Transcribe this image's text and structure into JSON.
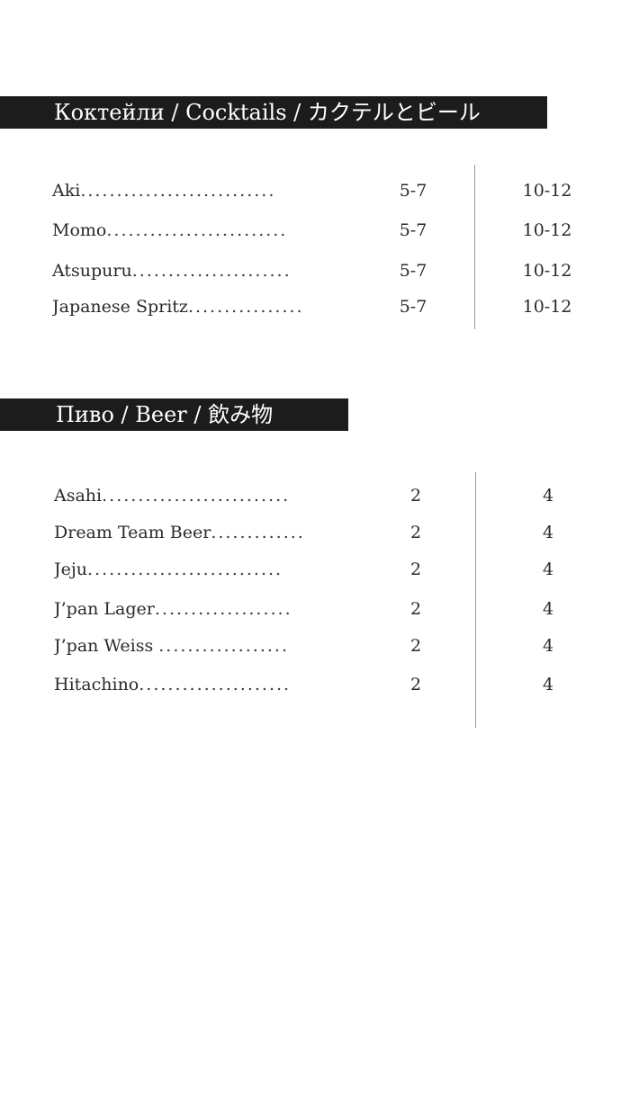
{
  "cocktails": {
    "title": "Коктейли / Cocktails / カクテルとビール",
    "items": [
      {
        "name": "Aki",
        "dots": "...........................",
        "small": "5-7",
        "large": "10-12"
      },
      {
        "name": "Momo",
        "dots": ".........................",
        "small": "5-7",
        "large": "10-12"
      },
      {
        "name": "Atsupuru",
        "dots": "......................",
        "small": "5-7",
        "large": "10-12"
      },
      {
        "name": "Japanese Spritz",
        "dots": "................",
        "small": "5-7",
        "large": "10-12"
      }
    ]
  },
  "beer": {
    "title": "Пиво / Beer / 飲み物",
    "items": [
      {
        "name": "Asahi",
        "dots": "..........................",
        "small": "2",
        "large": "4"
      },
      {
        "name": "Dream Team Beer",
        "dots": ".............",
        "small": "2",
        "large": "4"
      },
      {
        "name": "Jeju",
        "dots": "...........................",
        "small": "2",
        "large": "4"
      },
      {
        "name": "J’pan Lager",
        "dots": "...................",
        "small": "2",
        "large": "4"
      },
      {
        "name": "J’pan Weiss ",
        "dots": "..................",
        "small": "2",
        "large": "4"
      },
      {
        "name": "Hitachino",
        "dots": ".....................",
        "small": "2",
        "large": "4"
      }
    ]
  }
}
